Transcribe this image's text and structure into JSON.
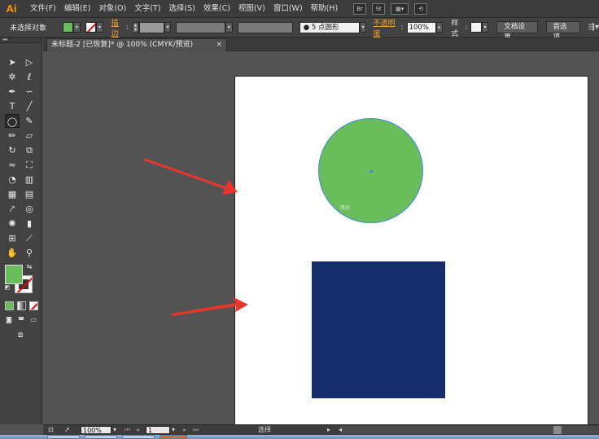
{
  "app": {
    "logo": "Ai"
  },
  "menu": {
    "items": [
      "文件(F)",
      "编辑(E)",
      "对象(O)",
      "文字(T)",
      "选择(S)",
      "效果(C)",
      "视图(V)",
      "窗口(W)",
      "帮助(H)"
    ],
    "icons": {
      "br": "Br",
      "st": "St",
      "layout": "▦▾",
      "sync": "⟲"
    }
  },
  "control": {
    "selection_label": "未选择对象",
    "fill_color": "#6bbd5b",
    "stroke_label": "描边",
    "brush_label": "● 5 点圆形",
    "opacity_label": "不透明度",
    "opacity_value": "100%",
    "style_label": "样式",
    "doc_setup_button": "文档设置",
    "prefs_button": "首选项",
    "colon": ":"
  },
  "document": {
    "tab_title": "未标题-2 [已恢复]* @ 100% (CMYK/预览)",
    "close_symbol": "×"
  },
  "canvas": {
    "circle_color": "#6bbd5b",
    "circle_label": "路径",
    "rect_color": "#152d6c",
    "arrow_color": "#e8362c"
  },
  "status": {
    "zoom": "100%",
    "page": "1",
    "tool_name": "选择"
  },
  "tools": [
    "selection-icon",
    "direct-selection-icon",
    "magic-wand-icon",
    "lasso-icon",
    "pen-icon",
    "curvature-icon",
    "type-icon",
    "line-icon",
    "ellipse-icon",
    "paintbrush-icon",
    "pencil-icon",
    "eraser-icon",
    "rotate-icon",
    "scale-icon",
    "width-icon",
    "free-transform-icon",
    "shape-builder-icon",
    "chart-icon",
    "mesh-icon",
    "gradient-icon",
    "eyedropper-icon",
    "blend-icon",
    "symbol-sprayer-icon",
    "column-graph-icon",
    "artboard-icon",
    "slice-icon",
    "hand-icon",
    "zoom-icon"
  ]
}
